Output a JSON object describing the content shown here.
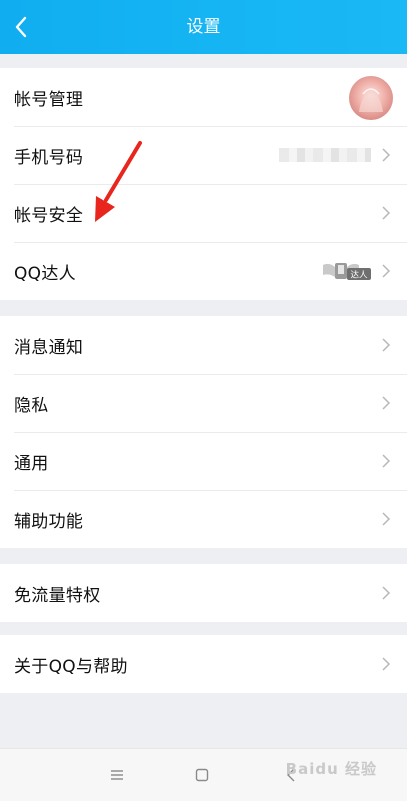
{
  "header": {
    "title": "设置"
  },
  "groups": [
    {
      "items": [
        {
          "label": "帐号管理"
        },
        {
          "label": "手机号码"
        },
        {
          "label": "帐号安全"
        },
        {
          "label": "QQ达人",
          "badge": "达人"
        }
      ]
    },
    {
      "items": [
        {
          "label": "消息通知"
        },
        {
          "label": "隐私"
        },
        {
          "label": "通用"
        },
        {
          "label": "辅助功能"
        }
      ]
    },
    {
      "items": [
        {
          "label": "免流量特权"
        }
      ]
    },
    {
      "items": [
        {
          "label": "关于QQ与帮助"
        }
      ]
    }
  ],
  "navbar": {
    "buttons": [
      "menu-icon",
      "home-icon",
      "back-icon"
    ]
  },
  "watermark": "Baidu 经验",
  "colors": {
    "header": "#12b0f2",
    "background": "#eeeff3",
    "arrow": "#e8261e"
  }
}
